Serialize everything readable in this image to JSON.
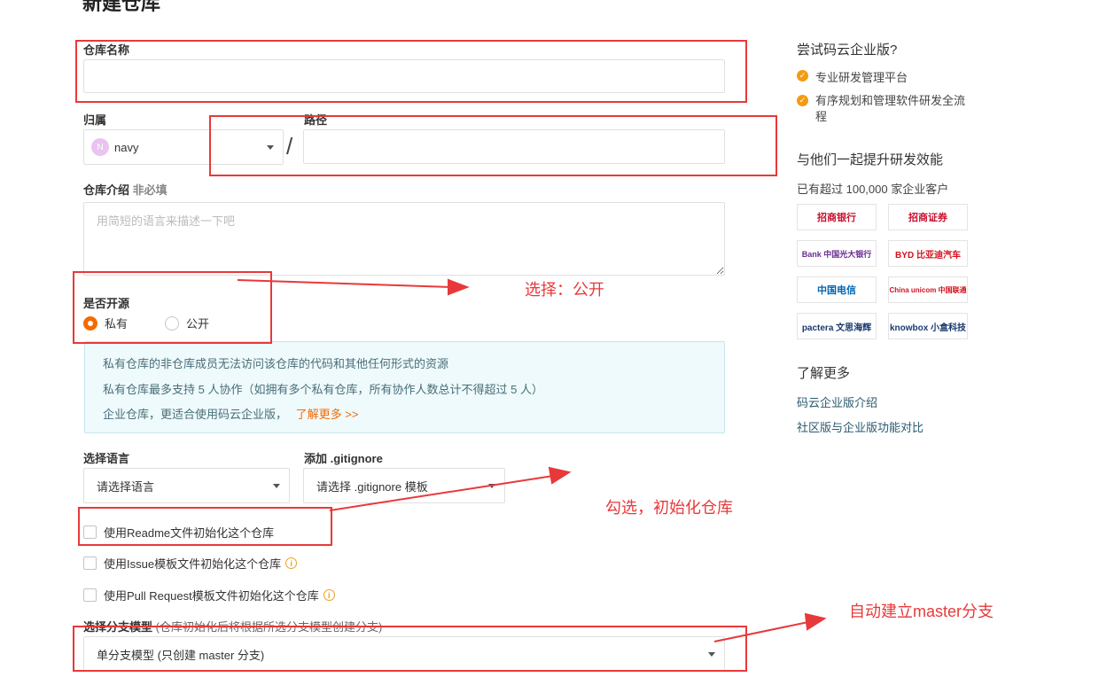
{
  "page": {
    "title": "新建仓库"
  },
  "form": {
    "repo_name_label": "仓库名称",
    "owner_label": "归属",
    "owner_avatar_letter": "N",
    "owner_value": "navy",
    "slash": "/",
    "path_label": "路径",
    "desc_label": "仓库介绍",
    "desc_optional": "非必填",
    "desc_placeholder": "用简短的语言来描述一下吧",
    "open_source_label": "是否开源",
    "visibility_options": [
      "私有",
      "公开"
    ],
    "visibility_selected": "私有",
    "info_lines": [
      "私有仓库的非仓库成员无法访问该仓库的代码和其他任何形式的资源",
      "私有仓库最多支持 5 人协作（如拥有多个私有仓库，所有协作人数总计不得超过 5 人）",
      "企业仓库，更适合使用码云企业版，"
    ],
    "info_more_link": "了解更多 >>",
    "language_label": "选择语言",
    "language_value": "请选择语言",
    "gitignore_label": "添加 .gitignore",
    "gitignore_value": "请选择 .gitignore 模板",
    "init_readme": "使用Readme文件初始化这个仓库",
    "init_issue": "使用Issue模板文件初始化这个仓库",
    "init_pr": "使用Pull Request模板文件初始化这个仓库",
    "branch_label": "选择分支模型",
    "branch_hint": "(仓库初始化后将根据所选分支模型创建分支)",
    "branch_value": "单分支模型 (只创建 master 分支)"
  },
  "annotations": {
    "choose_public": "选择：公开",
    "check_init": "勾选，初始化仓库",
    "auto_master": "自动建立master分支"
  },
  "sidebar": {
    "try_enterprise": "尝试码云企业版?",
    "features": [
      "专业研发管理平台",
      "有序规划和管理软件研发全流程"
    ],
    "together_heading": "与他们一起提升研发效能",
    "customers_text": "已有超过 100,000 家企业客户",
    "logos": [
      {
        "name": "招商银行",
        "color": "#c8102e"
      },
      {
        "name": "招商证券",
        "color": "#c8102e"
      },
      {
        "name": "Bank 中国光大银行",
        "color": "#6a2c91"
      },
      {
        "name": "BYD 比亚迪汽车",
        "color": "#d5121e"
      },
      {
        "name": "中国电信",
        "color": "#0065b3"
      },
      {
        "name": "China unicom 中国联通",
        "color": "#d5121e"
      },
      {
        "name": "pactera 文思海辉",
        "color": "#1a3a6e"
      },
      {
        "name": "knowbox 小盒科技",
        "color": "#1a3a6e"
      }
    ],
    "learn_more_heading": "了解更多",
    "links": [
      "码云企业版介绍",
      "社区版与企业版功能对比"
    ]
  },
  "colors": {
    "accent": "#f56a00",
    "annotation_red": "#e8393a"
  }
}
